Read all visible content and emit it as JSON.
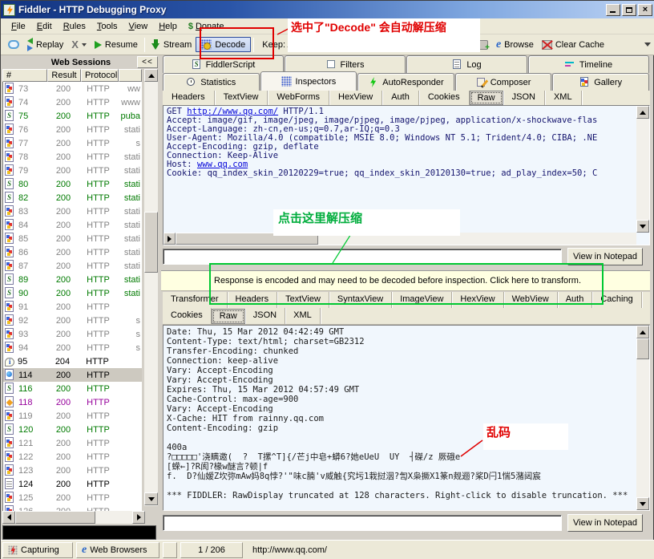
{
  "window": {
    "title": "Fiddler - HTTP Debugging Proxy"
  },
  "menu": {
    "items": [
      "File",
      "Edit",
      "Rules",
      "Tools",
      "View",
      "Help"
    ],
    "donate_icon": "$",
    "donate": "Donate"
  },
  "toolbar": {
    "replay": "Replay",
    "resume": "Resume",
    "stream": "Stream",
    "decode": "Decode",
    "keep": "Keep: A",
    "keep_tail": "e",
    "browse": "Browse",
    "clear_cache": "Clear Cache"
  },
  "annotations": {
    "decode_note": "选中了\"Decode\" 会自动解压缩",
    "click_note": "点击这里解压缩",
    "garbled_note": "乱码"
  },
  "sessions": {
    "title": "Web Sessions",
    "collapse": "<<",
    "columns": [
      "#",
      "Result",
      "Protocol",
      ""
    ],
    "rows": [
      {
        "id": "73",
        "result": "200",
        "protocol": "HTTP",
        "host": "ww",
        "type": "image",
        "color": "gray"
      },
      {
        "id": "74",
        "result": "200",
        "protocol": "HTTP",
        "host": "www",
        "type": "image",
        "color": "gray"
      },
      {
        "id": "75",
        "result": "200",
        "protocol": "HTTP",
        "host": "puba",
        "type": "script",
        "color": "green"
      },
      {
        "id": "76",
        "result": "200",
        "protocol": "HTTP",
        "host": "stati",
        "type": "image",
        "color": "gray"
      },
      {
        "id": "77",
        "result": "200",
        "protocol": "HTTP",
        "host": "s",
        "type": "image",
        "color": "gray"
      },
      {
        "id": "78",
        "result": "200",
        "protocol": "HTTP",
        "host": "stati",
        "type": "image",
        "color": "gray"
      },
      {
        "id": "79",
        "result": "200",
        "protocol": "HTTP",
        "host": "stati",
        "type": "image",
        "color": "gray"
      },
      {
        "id": "80",
        "result": "200",
        "protocol": "HTTP",
        "host": "stati",
        "type": "script",
        "color": "green"
      },
      {
        "id": "82",
        "result": "200",
        "protocol": "HTTP",
        "host": "stati",
        "type": "script",
        "color": "green"
      },
      {
        "id": "83",
        "result": "200",
        "protocol": "HTTP",
        "host": "stati",
        "type": "image",
        "color": "gray"
      },
      {
        "id": "84",
        "result": "200",
        "protocol": "HTTP",
        "host": "stati",
        "type": "image",
        "color": "gray"
      },
      {
        "id": "85",
        "result": "200",
        "protocol": "HTTP",
        "host": "stati",
        "type": "image",
        "color": "gray"
      },
      {
        "id": "86",
        "result": "200",
        "protocol": "HTTP",
        "host": "stati",
        "type": "image",
        "color": "gray"
      },
      {
        "id": "87",
        "result": "200",
        "protocol": "HTTP",
        "host": "stati",
        "type": "image",
        "color": "gray"
      },
      {
        "id": "89",
        "result": "200",
        "protocol": "HTTP",
        "host": "stati",
        "type": "script",
        "color": "green"
      },
      {
        "id": "90",
        "result": "200",
        "protocol": "HTTP",
        "host": "stati",
        "type": "script",
        "color": "green"
      },
      {
        "id": "91",
        "result": "200",
        "protocol": "HTTP",
        "host": "",
        "type": "image",
        "color": "gray"
      },
      {
        "id": "92",
        "result": "200",
        "protocol": "HTTP",
        "host": "s",
        "type": "image",
        "color": "gray"
      },
      {
        "id": "93",
        "result": "200",
        "protocol": "HTTP",
        "host": "s",
        "type": "image",
        "color": "gray"
      },
      {
        "id": "94",
        "result": "200",
        "protocol": "HTTP",
        "host": "s",
        "type": "image",
        "color": "gray"
      },
      {
        "id": "95",
        "result": "204",
        "protocol": "HTTP",
        "host": "",
        "type": "info",
        "color": "black"
      },
      {
        "id": "114",
        "result": "200",
        "protocol": "HTTP",
        "host": "",
        "type": "html",
        "color": "black",
        "selected": true
      },
      {
        "id": "116",
        "result": "200",
        "protocol": "HTTP",
        "host": "",
        "type": "script",
        "color": "green"
      },
      {
        "id": "118",
        "result": "200",
        "protocol": "HTTP",
        "host": "",
        "type": "css",
        "color": "purple"
      },
      {
        "id": "119",
        "result": "200",
        "protocol": "HTTP",
        "host": "",
        "type": "image",
        "color": "gray"
      },
      {
        "id": "120",
        "result": "200",
        "protocol": "HTTP",
        "host": "",
        "type": "script",
        "color": "green"
      },
      {
        "id": "121",
        "result": "200",
        "protocol": "HTTP",
        "host": "",
        "type": "image",
        "color": "gray"
      },
      {
        "id": "122",
        "result": "200",
        "protocol": "HTTP",
        "host": "",
        "type": "image",
        "color": "gray"
      },
      {
        "id": "123",
        "result": "200",
        "protocol": "HTTP",
        "host": "",
        "type": "image",
        "color": "gray"
      },
      {
        "id": "124",
        "result": "200",
        "protocol": "HTTP",
        "host": "",
        "type": "text",
        "color": "black"
      },
      {
        "id": "125",
        "result": "200",
        "protocol": "HTTP",
        "host": "",
        "type": "image",
        "color": "gray"
      },
      {
        "id": "126",
        "result": "200",
        "protocol": "HTTP",
        "host": "",
        "type": "image",
        "color": "gray"
      }
    ]
  },
  "tabs": {
    "row1": [
      "FiddlerScript",
      "Filters",
      "Log",
      "Timeline"
    ],
    "row2": [
      "Statistics",
      "Inspectors",
      "AutoResponder",
      "Composer",
      "Gallery"
    ],
    "row2_selected": "Inspectors",
    "inspector_tabs": [
      "Headers",
      "TextView",
      "WebForms",
      "HexView",
      "Auth",
      "Cookies",
      "Raw",
      "JSON",
      "XML"
    ],
    "inspector_selected": "Raw"
  },
  "request": {
    "lines": [
      {
        "pre": "GET ",
        "link": "http://www.qq.com/",
        "post": " HTTP/1.1"
      },
      {
        "text": "Accept: image/gif, image/jpeg, image/pjpeg, image/pjpeg, application/x-shockwave-flas"
      },
      {
        "text": "Accept-Language: zh-cn,en-us;q=0.7,ar-IQ;q=0.3"
      },
      {
        "text": "User-Agent: Mozilla/4.0 (compatible; MSIE 8.0; Windows NT 5.1; Trident/4.0; CIBA; .NE"
      },
      {
        "text": "Accept-Encoding: gzip, deflate"
      },
      {
        "text": "Connection: Keep-Alive"
      },
      {
        "pre": "Host: ",
        "link": "www.qq.com",
        "post": ""
      },
      {
        "text": "Cookie: qq_index_skin_20120229=true; qq_index_skin_20120130=true; ad_play_index=50; C"
      }
    ],
    "view_in_notepad": "View in Notepad"
  },
  "notice": {
    "text": "Response is encoded and may need to be decoded before inspection. Click here to transform."
  },
  "response_tabs": {
    "row1": [
      "Transformer",
      "Headers",
      "TextView",
      "SyntaxView",
      "ImageView",
      "HexView",
      "WebView",
      "Auth",
      "Caching"
    ],
    "row2": [
      "Cookies",
      "Raw",
      "JSON",
      "XML"
    ],
    "row2_selected": "Raw"
  },
  "response": {
    "lines": [
      "Date: Thu, 15 Mar 2012 04:42:49 GMT",
      "Content-Type: text/html; charset=GB2312",
      "Transfer-Encoding: chunked",
      "Connection: keep-alive",
      "Vary: Accept-Encoding",
      "Vary: Accept-Encoding",
      "Expires: Thu, 15 Mar 2012 04:57:49 GMT",
      "Cache-Control: max-age=900",
      "Vary: Accept-Encoding",
      "X-Cache: HIT from rainny.qq.com",
      "Content-Encoding: gzip",
      "",
      "400a",
      "?□□□□□'浇瞒邀(  ?  T摞^T]{/芒j中皂+蟒6?她eUeU  UY  ┤磔/z 厥硪e",
      "[蝾←]?R阂?椽w醚言?顿|f",
      "f.  D?仙嫒Z坎弥mAw妈8q悖?'\"味c腩'v威触{究圬1栽挝洇?訇X枭撅X1篆n觌逦?桨D闩1惴5潴闼宸",
      "",
      "*** FIDDLER: RawDisplay truncated at 128 characters. Right-click to disable truncation. ***"
    ],
    "view_in_notepad": "View in Notepad"
  },
  "statusbar": {
    "capturing": "Capturing",
    "browsers": "Web Browsers",
    "count": "1 / 206",
    "url": "http://www.qq.com/"
  }
}
